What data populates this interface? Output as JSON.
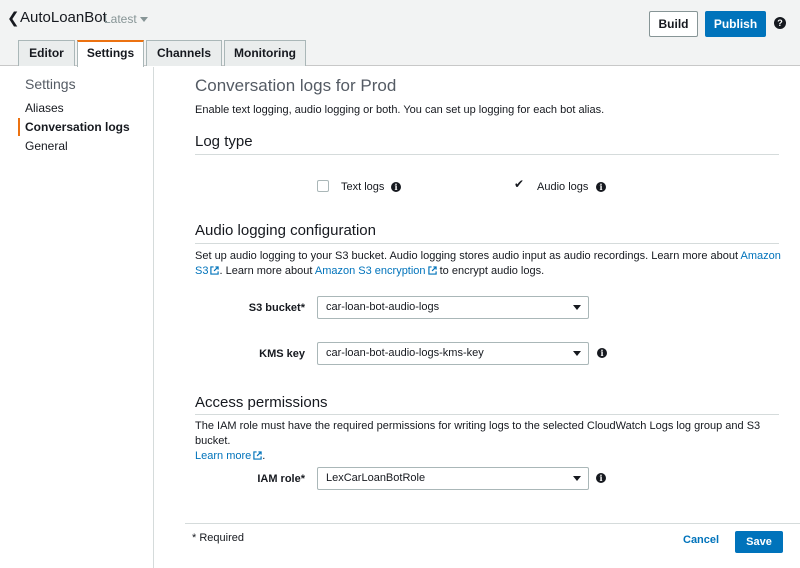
{
  "header": {
    "bot_name": "AutoLoanBot",
    "version": "Latest",
    "build_label": "Build",
    "publish_label": "Publish",
    "help_glyph": "?"
  },
  "tabs": [
    {
      "label": "Editor"
    },
    {
      "label": "Settings"
    },
    {
      "label": "Channels"
    },
    {
      "label": "Monitoring"
    }
  ],
  "sidebar": {
    "title": "Settings",
    "items": [
      {
        "label": "Aliases"
      },
      {
        "label": "Conversation logs"
      },
      {
        "label": "General"
      }
    ]
  },
  "main": {
    "title": "Conversation logs for Prod",
    "description": "Enable text logging, audio logging or both. You can set up logging for each bot alias.",
    "log_type": {
      "title": "Log type",
      "text_logs_label": "Text logs",
      "text_logs_checked": false,
      "audio_logs_label": "Audio logs",
      "audio_logs_checked": true
    },
    "audio_config": {
      "title": "Audio logging configuration",
      "desc_part1": "Set up audio logging to your S3 bucket. Audio logging stores audio input as audio recordings. Learn more about ",
      "link1": "Amazon S3",
      "desc_part2": ". Learn more about ",
      "link2": "Amazon S3 encryption",
      "desc_part3": " to encrypt audio logs.",
      "s3_bucket_label": "S3 bucket*",
      "s3_bucket_value": "car-loan-bot-audio-logs",
      "kms_key_label": "KMS key",
      "kms_key_value": "car-loan-bot-audio-logs-kms-key"
    },
    "access": {
      "title": "Access permissions",
      "desc": "The IAM role must have the required permissions for writing logs to the selected CloudWatch Logs log group and S3 bucket.",
      "learn_more": "Learn more",
      "period": ".",
      "iam_role_label": "IAM role*",
      "iam_role_value": "LexCarLoanBotRole"
    },
    "footer": {
      "required_note": "* Required",
      "cancel_label": "Cancel",
      "save_label": "Save"
    }
  },
  "colors": {
    "accent": "#0073bb",
    "tab_highlight": "#ec7211"
  }
}
